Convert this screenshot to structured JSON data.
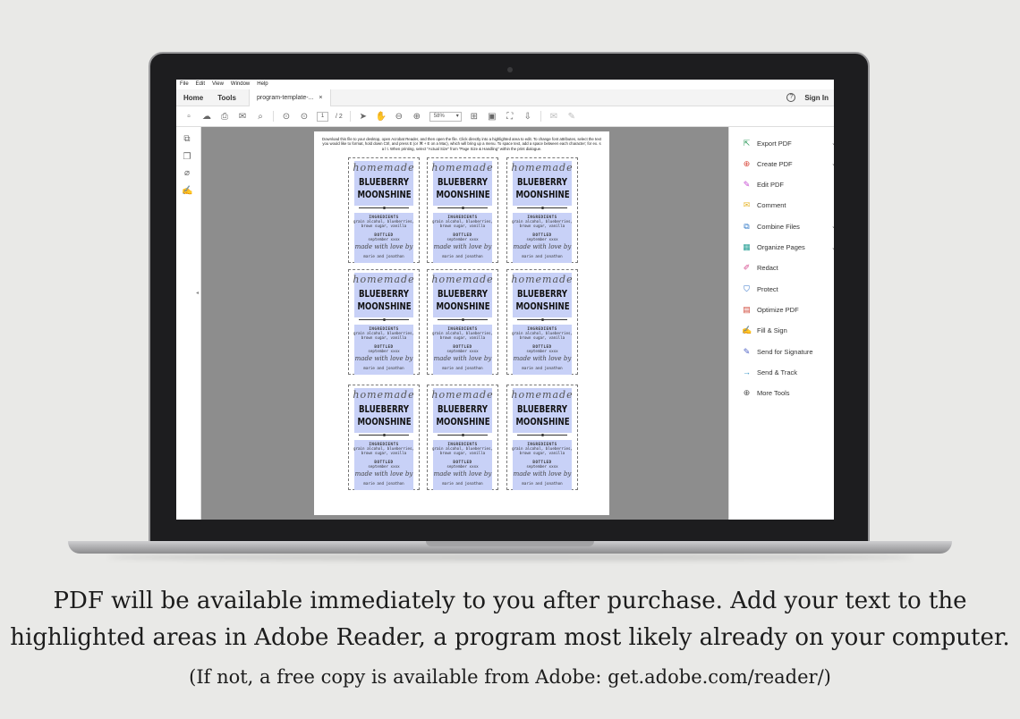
{
  "menubar": [
    "File",
    "Edit",
    "View",
    "Window",
    "Help"
  ],
  "tabs": {
    "home": "Home",
    "tools": "Tools",
    "document": "program-template-...",
    "close": "×",
    "signin": "Sign In",
    "help": "?"
  },
  "toolbar": {
    "page_current": "1",
    "page_total": "/ 2",
    "zoom": "58%"
  },
  "document": {
    "instructions": "Download this file to your desktop, open Acrobat Reader, and then open the file.  Click directly into a highlighted area to edit. To change font attributes, select the text you would like to format, hold down Ctrl, and press E (or ⌘ + E on a Mac), which will bring up a menu.  To space text, add a space between each character; for ex. s a l t.  When printing, select \"Actual Size\" from \"Page Size & Handling\" within the print dialogue.",
    "label": {
      "script": "homemade",
      "line1": "BLUEBERRY",
      "line2": "MOONSHINE",
      "ingredients_title": "INGREDIENTS",
      "ingredients_1": "grain alcohol, blueberries,",
      "ingredients_2": "brown sugar, vanilla",
      "bottled_title": "BOTTLED",
      "bottled_date": "september xxxx",
      "made_with": "made with love by",
      "makers": "marie and jonathon"
    }
  },
  "tools": [
    {
      "label": "Export PDF",
      "icon": "export-pdf-icon",
      "glyph": "⇱",
      "color": "#2e9a5a",
      "chevron": true
    },
    {
      "label": "Create PDF",
      "icon": "create-pdf-icon",
      "glyph": "⊕",
      "color": "#d9483b",
      "chevron": true
    },
    {
      "label": "Edit PDF",
      "icon": "edit-pdf-icon",
      "glyph": "✎",
      "color": "#c64ad2",
      "chevron": false
    },
    {
      "label": "Comment",
      "icon": "comment-icon",
      "glyph": "✉",
      "color": "#e7b52a",
      "chevron": false
    },
    {
      "label": "Combine Files",
      "icon": "combine-files-icon",
      "glyph": "⧉",
      "color": "#2f78c7",
      "chevron": true
    },
    {
      "label": "Organize Pages",
      "icon": "organize-pages-icon",
      "glyph": "▦",
      "color": "#28a096",
      "chevron": true
    },
    {
      "label": "Redact",
      "icon": "redact-icon",
      "glyph": "✐",
      "color": "#d44a8e",
      "chevron": false
    },
    {
      "label": "Protect",
      "icon": "protect-icon",
      "glyph": "⛉",
      "color": "#2f6fc7",
      "chevron": false
    },
    {
      "label": "Optimize PDF",
      "icon": "optimize-pdf-icon",
      "glyph": "▤",
      "color": "#d14b3c",
      "chevron": false
    },
    {
      "label": "Fill & Sign",
      "icon": "fill-sign-icon",
      "glyph": "✍",
      "color": "#7a55c9",
      "chevron": false
    },
    {
      "label": "Send for Signature",
      "icon": "send-signature-icon",
      "glyph": "✎",
      "color": "#4b5fc4",
      "chevron": false
    },
    {
      "label": "Send & Track",
      "icon": "send-track-icon",
      "glyph": "→",
      "color": "#2c8fc4",
      "chevron": false
    },
    {
      "label": "More Tools",
      "icon": "more-tools-icon",
      "glyph": "⊕",
      "color": "#555555",
      "chevron": false
    }
  ],
  "caption": {
    "line1": "PDF will be available immediately to you after purchase.  Add your text to the",
    "line2": "highlighted areas in Adobe Reader, a program most likely already on your computer.",
    "line3": "(If not, a free copy is available from Adobe: get.adobe.com/reader/)"
  }
}
